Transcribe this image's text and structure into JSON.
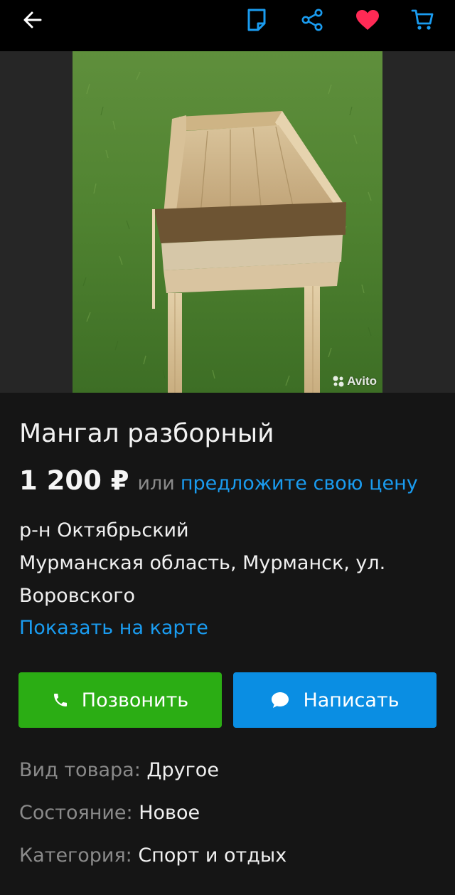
{
  "header": {
    "back_icon": "arrow-left-icon",
    "note_icon": "note-icon",
    "share_icon": "share-icon",
    "favorite_icon": "heart-icon",
    "cart_icon": "cart-icon",
    "accent_color": "#1a9cf0",
    "favorite_color": "#ff2a55"
  },
  "photo": {
    "watermark": "Avito"
  },
  "listing": {
    "title": "Мангал разборный",
    "price": "1 200 ₽",
    "or_text": "или",
    "offer_link": "предложите свою цену",
    "district": "р-н Октябрьский",
    "address_line1": "Мурманская область, Мурманск, ул.",
    "address_line2": "Воровского",
    "map_link": "Показать на карте"
  },
  "actions": {
    "call_label": "Позвонить",
    "write_label": "Написать",
    "call_color": "#2bad14",
    "write_color": "#0a8ee3"
  },
  "params": [
    {
      "label": "Вид товара:",
      "value": "Другое"
    },
    {
      "label": "Состояние:",
      "value": "Новое"
    },
    {
      "label": "Категория:",
      "value": "Спорт и отдых"
    }
  ]
}
